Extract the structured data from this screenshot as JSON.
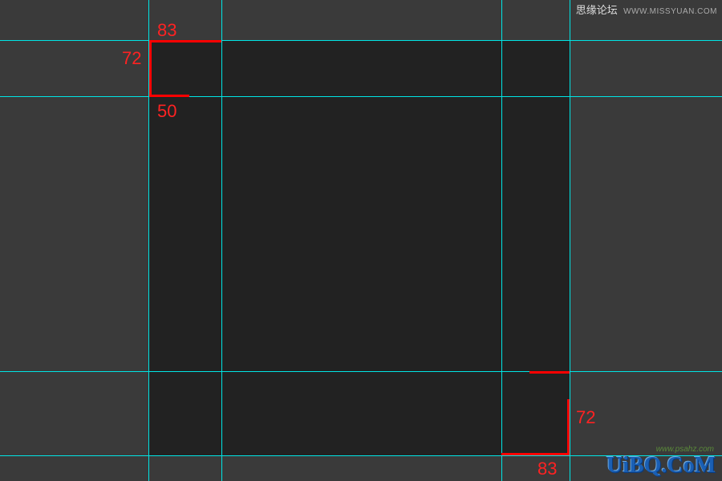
{
  "guides": {
    "h1": 50,
    "h2": 120,
    "h3": 463,
    "h4": 568,
    "v1": 185,
    "v2": 276,
    "v3": 625,
    "v4": 710
  },
  "measurements": {
    "top_width": "83",
    "top_height": "72",
    "top_offset": "50",
    "bottom_width": "83",
    "bottom_height": "72"
  },
  "watermark": {
    "top_cn": "思缘论坛",
    "top_url": "WWW.MISSYUAN.COM",
    "bottom_logo": "UiBQ.CoM",
    "bottom_sub": "www.psahz.com"
  }
}
